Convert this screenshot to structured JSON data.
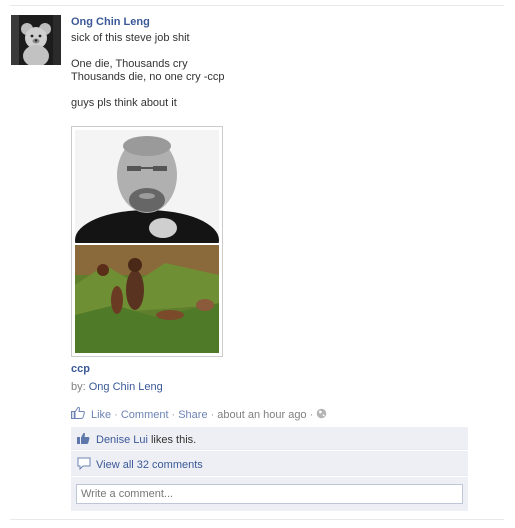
{
  "post": {
    "author": "Ong Chin Leng",
    "message_lines": [
      "sick of this steve job shit",
      "",
      "One die, Thousands cry",
      "Thousands die, no one cry -ccp",
      "",
      "guys pls think about it"
    ],
    "link_title": "ccp",
    "by_prefix": "by:",
    "by_name": "Ong Chin Leng"
  },
  "actions": {
    "like": "Like",
    "comment": "Comment",
    "share": "Share",
    "time": "about an hour ago",
    "dot": "·"
  },
  "ufi": {
    "liker": "Denise Lui",
    "likes_suffix": "likes this.",
    "view_comments": "View all 32 comments",
    "comment_placeholder": "Write a comment..."
  },
  "colors": {
    "link_blue": "#3b5998",
    "ufi_background": "#edeff4",
    "muted_text": "#808080"
  },
  "icons": {
    "avatar": "teddy-bear-avatar",
    "like": "thumbs-up-icon",
    "comments": "comment-bubble-icon",
    "privacy": "globe-icon"
  }
}
